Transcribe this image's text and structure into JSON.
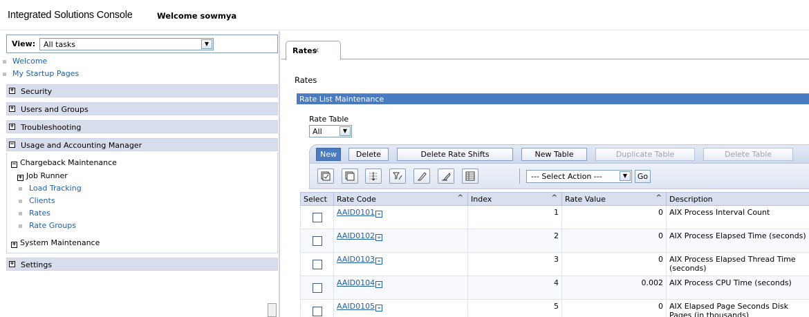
{
  "header": {
    "app_title": "Integrated Solutions Console",
    "welcome": "Welcome sowmya"
  },
  "nav": {
    "view_label": "View:",
    "view_selected": "All tasks",
    "links": [
      "Welcome",
      "My Startup Pages"
    ],
    "sections": {
      "security": "Security",
      "users_groups": "Users and Groups",
      "troubleshooting": "Troubleshooting",
      "usage_accounting": "Usage and Accounting Manager",
      "settings": "Settings"
    },
    "tree": {
      "chargeback": "Chargeback Maintenance",
      "job_runner": "Job Runner",
      "leaves": [
        "Load Tracking",
        "Clients",
        "Rates",
        "Rate Groups"
      ],
      "system_maintenance": "System Maintenance"
    },
    "expand_symbol": "+",
    "collapse_symbol": "−"
  },
  "main": {
    "tab_label": "Rates",
    "tab_close": "×",
    "breadcrumb": "Rates",
    "panel_title": "Rate List Maintenance",
    "rate_table_label": "Rate Table",
    "rate_table_value": "All",
    "buttons": {
      "new": "New",
      "delete": "Delete",
      "delete_rate_shifts": "Delete Rate Shifts",
      "new_table": "New Table",
      "duplicate_table": "Duplicate Table",
      "delete_table": "Delete Table"
    },
    "action_select": "--- Select Action ---",
    "go": "Go",
    "columns": {
      "select": "Select",
      "rate_code": "Rate Code",
      "index": "Index",
      "rate_value": "Rate Value",
      "description": "Description"
    },
    "sort_glyph": "^",
    "rows": [
      {
        "code": "AAID0101",
        "index": "1",
        "value": "0",
        "desc": "AIX Process Interval Count"
      },
      {
        "code": "AAID0102",
        "index": "2",
        "value": "0",
        "desc": "AIX Process Elapsed Time (seconds)"
      },
      {
        "code": "AAID0103",
        "index": "3",
        "value": "0",
        "desc": "AIX Process Elapsed Thread Time (seconds)"
      },
      {
        "code": "AAID0104",
        "index": "4",
        "value": "0.002",
        "desc": "AIX Process CPU Time (seconds)"
      },
      {
        "code": "AAID0105",
        "index": "5",
        "value": "0",
        "desc": "AIX Elapsed Page Seconds Disk Pages (in thousands)"
      }
    ]
  },
  "colors": {
    "accent": "#4a7bc0",
    "nav_section_bg": "#d8ddec",
    "link": "#2060a8"
  }
}
